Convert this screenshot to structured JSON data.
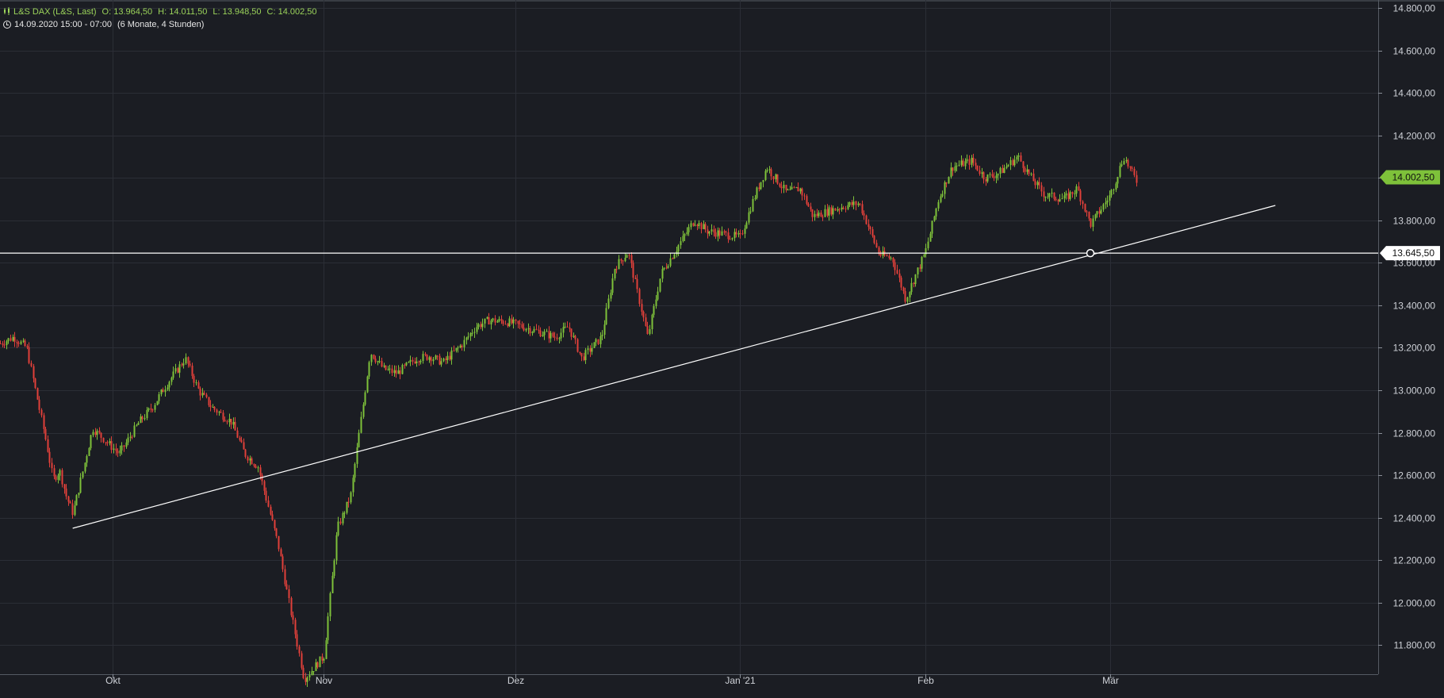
{
  "header": {
    "instrument": "L&S DAX (L&S, Last)",
    "open": "O: 13.964,50",
    "high": "H: 14.011,50",
    "low": "L: 13.948,50",
    "close": "C: 14.002,50",
    "range": "14.09.2020 15:00 - 07:00",
    "period": "(6 Monate, 4 Stunden)"
  },
  "colors": {
    "background": "#1b1d23",
    "up": "#7ec13a",
    "down": "#e0403a",
    "grid": "#2b2e36",
    "axis_text": "#cfd2d8",
    "last_price_tag": "#7ec13a",
    "line": "#ffffff"
  },
  "chart_data": {
    "type": "candlestick",
    "title": "",
    "xlabel": "",
    "ylabel": "",
    "ylim": [
      11700,
      14800
    ],
    "y_ticks": [
      "14.800,00",
      "14.600,00",
      "14.400,00",
      "14.200,00",
      "14.000,00",
      "13.800,00",
      "13.600,00",
      "13.400,00",
      "13.200,00",
      "13.000,00",
      "12.800,00",
      "12.600,00",
      "12.400,00",
      "12.200,00",
      "12.000,00",
      "11.800,00"
    ],
    "y_tick_values": [
      14800,
      14600,
      14400,
      14200,
      14000,
      13800,
      13600,
      13400,
      13200,
      13000,
      12800,
      12600,
      12400,
      12200,
      12000,
      11800
    ],
    "x_labels": [
      "Okt",
      "Nov",
      "Dez",
      "Jan '21",
      "Feb",
      "Mär"
    ],
    "x_label_dates": [
      "2020-10-01",
      "2020-11-02",
      "2020-12-01",
      "2021-01-04",
      "2021-02-01",
      "2021-03-01"
    ],
    "grid": true,
    "last_price": 14002.5,
    "last_price_label": "14.002,50",
    "horizontal_line": {
      "value": 13645.5,
      "label": "13.645,50"
    },
    "trend_line": {
      "from": {
        "date": "2020-09-25",
        "value": 12350
      },
      "to": {
        "date": "2021-03-26",
        "value": 13870
      }
    },
    "close_path": [
      [
        "2020-09-14",
        13220
      ],
      [
        "2020-09-16",
        13250
      ],
      [
        "2020-09-18",
        13200
      ],
      [
        "2020-09-21",
        12750
      ],
      [
        "2020-09-22",
        12580
      ],
      [
        "2020-09-23",
        12620
      ],
      [
        "2020-09-24",
        12500
      ],
      [
        "2020-09-25",
        12420
      ],
      [
        "2020-09-28",
        12820
      ],
      [
        "2020-09-30",
        12760
      ],
      [
        "2020-10-02",
        12700
      ],
      [
        "2020-10-05",
        12850
      ],
      [
        "2020-10-07",
        12920
      ],
      [
        "2020-10-09",
        13020
      ],
      [
        "2020-10-12",
        13150
      ],
      [
        "2020-10-14",
        13000
      ],
      [
        "2020-10-16",
        12920
      ],
      [
        "2020-10-19",
        12850
      ],
      [
        "2020-10-21",
        12700
      ],
      [
        "2020-10-23",
        12640
      ],
      [
        "2020-10-26",
        12280
      ],
      [
        "2020-10-28",
        11950
      ],
      [
        "2020-10-30",
        11640
      ],
      [
        "2020-11-02",
        11750
      ],
      [
        "2020-11-04",
        12350
      ],
      [
        "2020-11-06",
        12500
      ],
      [
        "2020-11-09",
        13180
      ],
      [
        "2020-11-11",
        13100
      ],
      [
        "2020-11-13",
        13080
      ],
      [
        "2020-11-16",
        13150
      ],
      [
        "2020-11-18",
        13160
      ],
      [
        "2020-11-20",
        13130
      ],
      [
        "2020-11-23",
        13220
      ],
      [
        "2020-11-25",
        13300
      ],
      [
        "2020-11-27",
        13330
      ],
      [
        "2020-11-30",
        13320
      ],
      [
        "2020-12-02",
        13300
      ],
      [
        "2020-12-04",
        13280
      ],
      [
        "2020-12-07",
        13250
      ],
      [
        "2020-12-09",
        13300
      ],
      [
        "2020-12-11",
        13150
      ],
      [
        "2020-12-14",
        13250
      ],
      [
        "2020-12-16",
        13580
      ],
      [
        "2020-12-18",
        13650
      ],
      [
        "2020-12-21",
        13250
      ],
      [
        "2020-12-23",
        13550
      ],
      [
        "2020-12-28",
        13800
      ],
      [
        "2020-12-30",
        13750
      ],
      [
        "2021-01-04",
        13720
      ],
      [
        "2021-01-06",
        13900
      ],
      [
        "2021-01-08",
        14050
      ],
      [
        "2021-01-11",
        13930
      ],
      [
        "2021-01-13",
        13950
      ],
      [
        "2021-01-15",
        13820
      ],
      [
        "2021-01-18",
        13850
      ],
      [
        "2021-01-20",
        13870
      ],
      [
        "2021-01-22",
        13880
      ],
      [
        "2021-01-25",
        13640
      ],
      [
        "2021-01-27",
        13620
      ],
      [
        "2021-01-29",
        13430
      ],
      [
        "2021-02-01",
        13650
      ],
      [
        "2021-02-03",
        13900
      ],
      [
        "2021-02-05",
        14050
      ],
      [
        "2021-02-08",
        14080
      ],
      [
        "2021-02-10",
        14000
      ],
      [
        "2021-02-12",
        14020
      ],
      [
        "2021-02-15",
        14100
      ],
      [
        "2021-02-17",
        14000
      ],
      [
        "2021-02-19",
        13920
      ],
      [
        "2021-02-22",
        13900
      ],
      [
        "2021-02-24",
        13950
      ],
      [
        "2021-02-26",
        13780
      ],
      [
        "2021-03-01",
        13920
      ],
      [
        "2021-03-03",
        14100
      ],
      [
        "2021-03-05",
        13980
      ]
    ]
  }
}
